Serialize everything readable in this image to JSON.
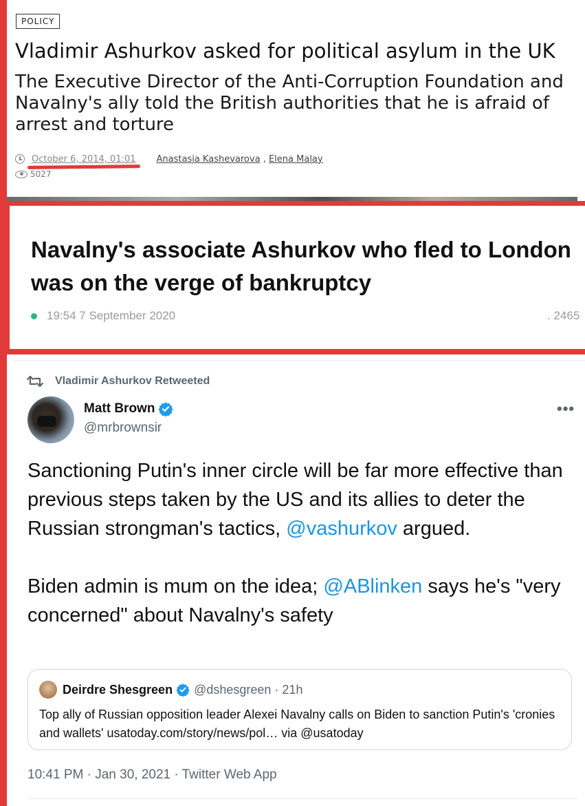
{
  "article1": {
    "tag": "POLICY",
    "title": "Vladimir Ashurkov asked for political asylum in the UK",
    "subtitle": "The Executive Director of the Anti-Corruption Foundation and Navalny's ally told the British authorities that he is afraid of arrest and torture",
    "date": "October 6, 2014, 01:01",
    "author1": "Anastasia Kashevarova",
    "author_sep": ",",
    "author2": "Elena Malay",
    "views": "5027"
  },
  "article2": {
    "headline": "Navalny's associate Ashurkov who fled to London was on the verge of bankruptcy",
    "time": "19:54 7 September 2020",
    "views": "2465"
  },
  "tweet": {
    "retweeted_by": "Vladimir Ashurkov Retweeted",
    "name": "Matt Brown",
    "handle": "@mrbrownsir",
    "more": "•••",
    "text_part1": "Sanctioning Putin's inner circle will be far more effective than previous steps taken by the US and its allies to deter the Russian strongman's tactics, ",
    "mention1": "@vashurkov",
    "text_part2": " argued.",
    "text_part3": "Biden admin is mum on the idea; ",
    "mention2": "@ABlinken",
    "text_part4": " says he's \"very concerned\" about Navalny's safety",
    "quote": {
      "name": "Deirdre Shesgreen",
      "handle": "@dshesgreen · 21h",
      "text": "Top ally of Russian opposition leader Alexei Navalny calls on Biden to sanction Putin's 'cronies and wallets' usatoday.com/story/news/pol… via @usatoday"
    },
    "meta": "10:41 PM · Jan 30, 2021 · Twitter Web App"
  },
  "colors": {
    "annotation_red": "#e23a3a",
    "twitter_blue": "#1b95e0",
    "green_dot": "#2bb38a"
  },
  "icons": [
    "clock-icon",
    "eye-icon",
    "retweet-icon",
    "verified-icon",
    "more-icon"
  ]
}
